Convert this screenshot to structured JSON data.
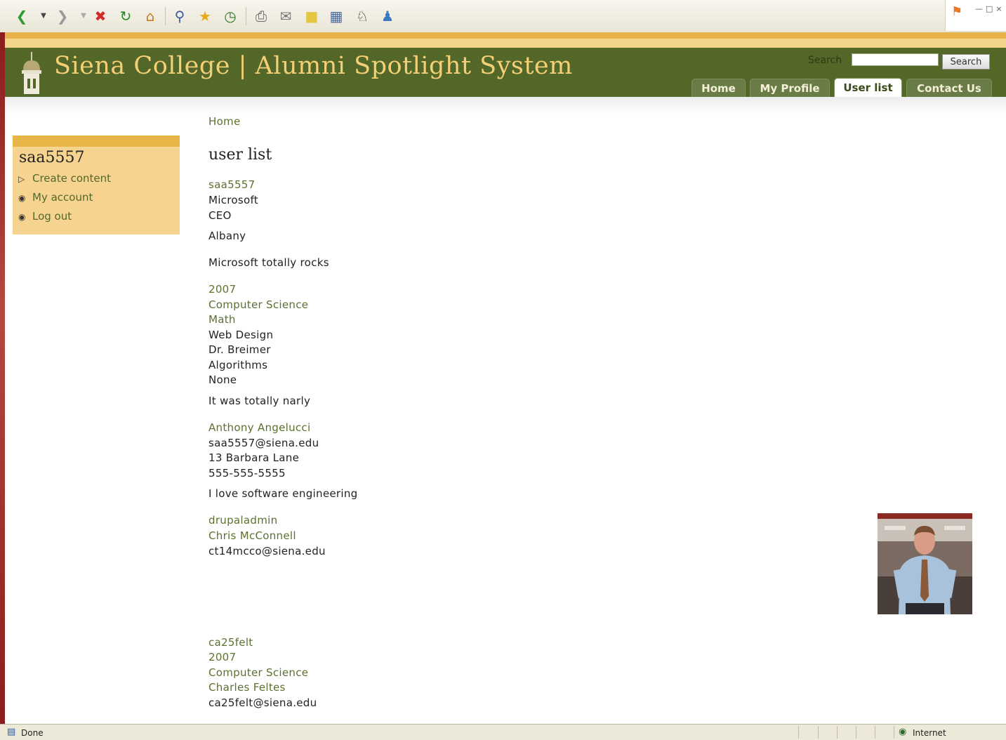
{
  "header": {
    "site_title": "Siena College | Alumni Spotlight System",
    "search_label": "Search",
    "search_button": "Search",
    "search_value": ""
  },
  "nav": {
    "tabs": [
      {
        "label": "Home",
        "active": false
      },
      {
        "label": "My Profile",
        "active": false
      },
      {
        "label": "User list",
        "active": true
      },
      {
        "label": "Contact Us",
        "active": false
      }
    ]
  },
  "sidebar": {
    "title": "saa5557",
    "items": [
      {
        "label": "Create content"
      },
      {
        "label": "My account"
      },
      {
        "label": "Log out"
      }
    ]
  },
  "main": {
    "breadcrumb": "Home",
    "heading": "user list",
    "user1": {
      "username": "saa5557",
      "company": "Microsoft",
      "title": "CEO",
      "city": "Albany",
      "comment": "Microsoft totally rocks",
      "year": "2007",
      "major": "Computer Science",
      "minor": "Math",
      "course": "Web Design",
      "professor": "Dr. Breimer",
      "class": "Algorithms",
      "other": "None",
      "experience": "It was totally narly",
      "full_name": "Anthony Angelucci",
      "email": "saa5557@siena.edu",
      "address": "13 Barbara Lane",
      "phone": "555-555-5555",
      "bio": "I love software engineering"
    },
    "user2": {
      "username": "drupaladmin",
      "full_name": "Chris McConnell",
      "email": "ct14mcco@siena.edu"
    },
    "user3": {
      "username": "ca25felt",
      "year": "2007",
      "major": "Computer Science",
      "full_name": "Charles Feltes",
      "email": "ca25felt@siena.edu"
    }
  },
  "statusbar": {
    "status": "Done",
    "zone": "Internet"
  },
  "colors": {
    "header_green": "#536729",
    "title_gold": "#f4cf75",
    "link_green": "#5c7030",
    "sidebar_bg": "#f6d48f"
  }
}
